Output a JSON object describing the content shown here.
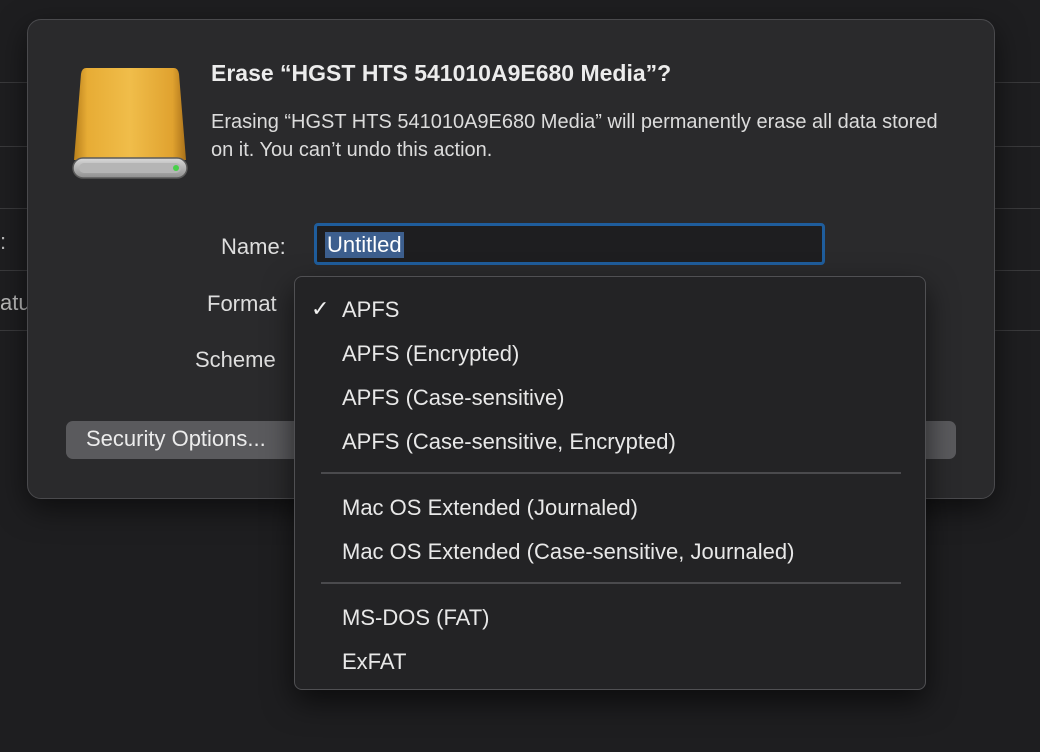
{
  "background": {
    "fragments": [
      ":",
      "atu"
    ]
  },
  "dialog": {
    "title": "Erase “HGST HTS 541010A9E680 Media”?",
    "message": "Erasing “HGST HTS 541010A9E680 Media” will permanently erase all data stored on it. You can’t undo this action.",
    "name_label": "Name:",
    "name_value": "Untitled",
    "format_label": "Format",
    "scheme_label": "Scheme",
    "security_button": "Security Options..."
  },
  "format_menu": {
    "selected": "APFS",
    "check_glyph": "✓",
    "groups": [
      [
        "APFS",
        "APFS (Encrypted)",
        "APFS (Case-sensitive)",
        "APFS (Case-sensitive, Encrypted)"
      ],
      [
        "Mac OS Extended (Journaled)",
        "Mac OS Extended (Case-sensitive, Journaled)"
      ],
      [
        "MS-DOS (FAT)",
        "ExFAT"
      ]
    ]
  },
  "colors": {
    "accent": "#1f5d9c",
    "drive": "#e3a52c"
  }
}
